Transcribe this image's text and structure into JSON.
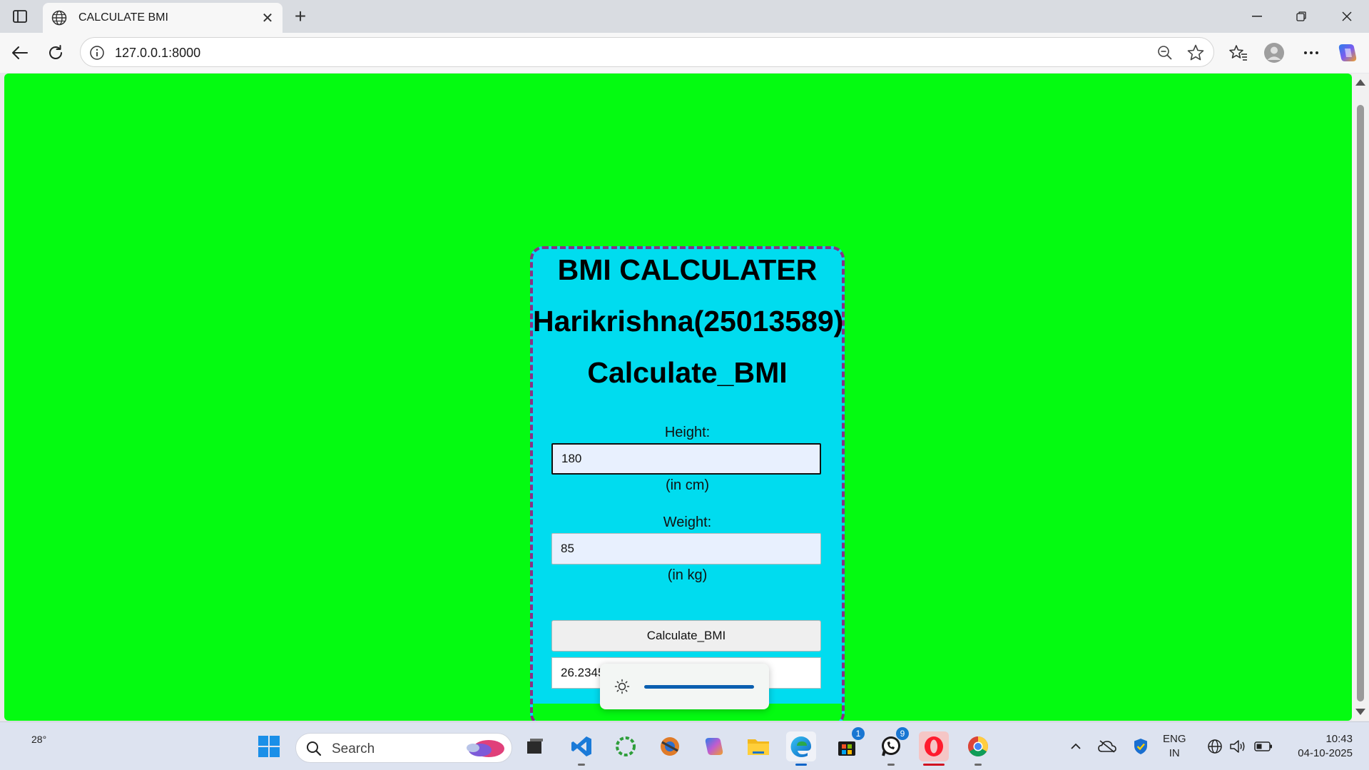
{
  "browser": {
    "tab_title": "CALCULATE BMI",
    "url": "127.0.0.1:8000"
  },
  "page": {
    "title": "BMI CALCULATER",
    "author": "Harikrishna(25013589)",
    "subtitle": "Calculate_BMI",
    "height_label": "Height:",
    "height_value": "180",
    "height_unit": "(in cm)",
    "weight_label": "Weight:",
    "weight_value": "85",
    "weight_unit": "(in kg)",
    "button_label": "Calculate_BMI",
    "result_value": "26.2345",
    "background_color": "#04fb11",
    "card_color": "#00dcef",
    "card_border_color": "#8a2f86"
  },
  "brightness": {
    "level": 1.0
  },
  "taskbar": {
    "weather_temp": "28°",
    "search_placeholder": "Search",
    "apps": [
      "vscode-icon",
      "spinner-icon",
      "photos-icon",
      "copilot-icon",
      "file-explorer-icon",
      "edge-icon",
      "store-icon",
      "whatsapp-icon",
      "opera-icon",
      "chrome-icon"
    ],
    "store_badge": "1",
    "whatsapp_badge": "9",
    "lang_line1": "ENG",
    "lang_line2": "IN",
    "time": "10:43",
    "date": "04-10-2025"
  }
}
